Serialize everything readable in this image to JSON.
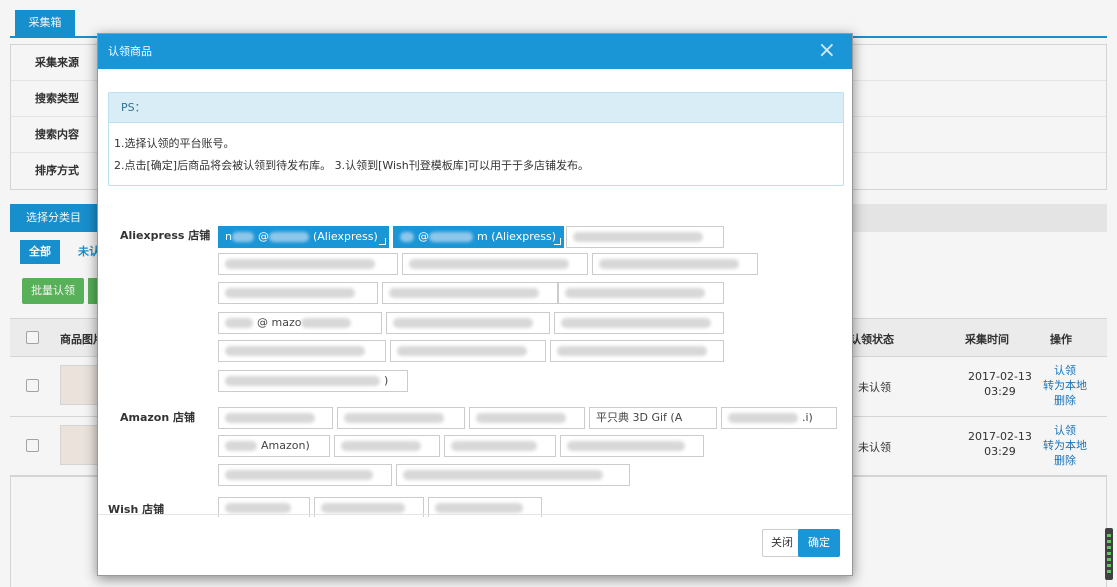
{
  "page": {
    "top_tab": "采集箱",
    "filter_rows": [
      "采集来源",
      "搜索类型",
      "搜索内容",
      "排序方式"
    ],
    "category_label": "选择分类目录：",
    "subtab_all": "全部",
    "subtab_other": "未认",
    "batch_button": "批量认领",
    "table": {
      "headers": {
        "image": "商品图片",
        "status": "认领状态",
        "time": "采集时间",
        "ops": "操作"
      },
      "rows": [
        {
          "status": "未认领",
          "date": "2017-02-13",
          "clock": "03:29",
          "ops": [
            "认领",
            "转为本地",
            "删除"
          ]
        },
        {
          "status": "未认领",
          "date": "2017-02-13",
          "clock": "03:29",
          "ops": [
            "认领",
            "转为本地",
            "删除"
          ]
        }
      ]
    }
  },
  "modal": {
    "title": "认领商品",
    "close_glyph": "×",
    "ps_title": "PS：",
    "ps_lines": [
      "1.选择认领的平台账号。",
      "2.点击[确定]后商品将会被认领到待发布库。 3.认领到[Wish刊登模板库]可以用于于多店铺发布。"
    ],
    "stores": {
      "aliexpress": {
        "label": "Aliexpress 店铺",
        "selected": [
          {
            "pre": "n",
            "mid": "@",
            "tail": "(Aliexpress)"
          },
          {
            "pre": "",
            "mid": "@",
            "tail": "m (Aliexpress)"
          }
        ],
        "fragments": [
          ")",
          "@ mazo",
          ")"
        ]
      },
      "amazon": {
        "label": "Amazon 店铺",
        "fragments": [
          "平只典 3D Gif (A",
          ".i)",
          "Amazon)"
        ]
      },
      "wish": {
        "label": "Wish 店铺"
      }
    },
    "footer": {
      "close_label": "关闭",
      "ok_label": "确定"
    }
  },
  "colors": {
    "accent": "#1a95d6",
    "green": "#5cb85c",
    "link": "#1a78c2"
  }
}
